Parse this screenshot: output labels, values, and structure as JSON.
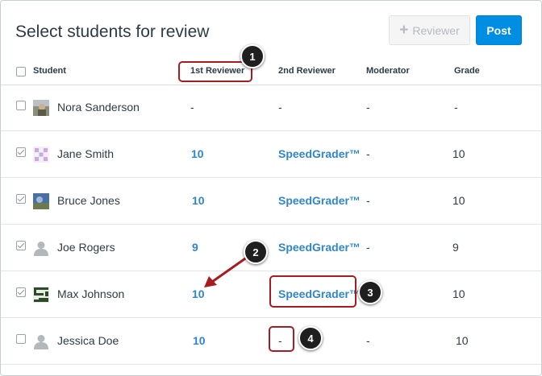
{
  "header": {
    "title": "Select students for review",
    "reviewer_button_label": "Reviewer",
    "post_button_label": "Post"
  },
  "columns": {
    "student": "Student",
    "first_reviewer": "1st Reviewer",
    "second_reviewer": "2nd Reviewer",
    "moderator": "Moderator",
    "grade": "Grade"
  },
  "rows": [
    {
      "name": "Nora Sanderson",
      "checked": false,
      "avatar": "photo",
      "first": "-",
      "second": "-",
      "moderator": "-",
      "grade": "-"
    },
    {
      "name": "Jane Smith",
      "checked": true,
      "avatar": "pattern",
      "first": "10",
      "second": "SpeedGrader™",
      "moderator": "-",
      "grade": "10"
    },
    {
      "name": "Bruce Jones",
      "checked": true,
      "avatar": "photo",
      "first": "10",
      "second": "SpeedGrader™",
      "moderator": "-",
      "grade": "10"
    },
    {
      "name": "Joe Rogers",
      "checked": true,
      "avatar": "default",
      "first": "9",
      "second": "SpeedGrader™",
      "moderator": "-",
      "grade": "9"
    },
    {
      "name": "Max Johnson",
      "checked": true,
      "avatar": "maze",
      "first": "10",
      "second": "SpeedGrader™",
      "moderator": "-",
      "grade": "10"
    },
    {
      "name": "Jessica Doe",
      "checked": false,
      "avatar": "default",
      "first": "10",
      "second": "-",
      "moderator": "-",
      "grade": "10"
    }
  ],
  "callouts": [
    "1",
    "2",
    "3",
    "4"
  ],
  "colors": {
    "link": "#2f86c9",
    "primary_button": "#008ee2",
    "callout_border": "#a81c21",
    "badge": "#1f1f1f"
  }
}
